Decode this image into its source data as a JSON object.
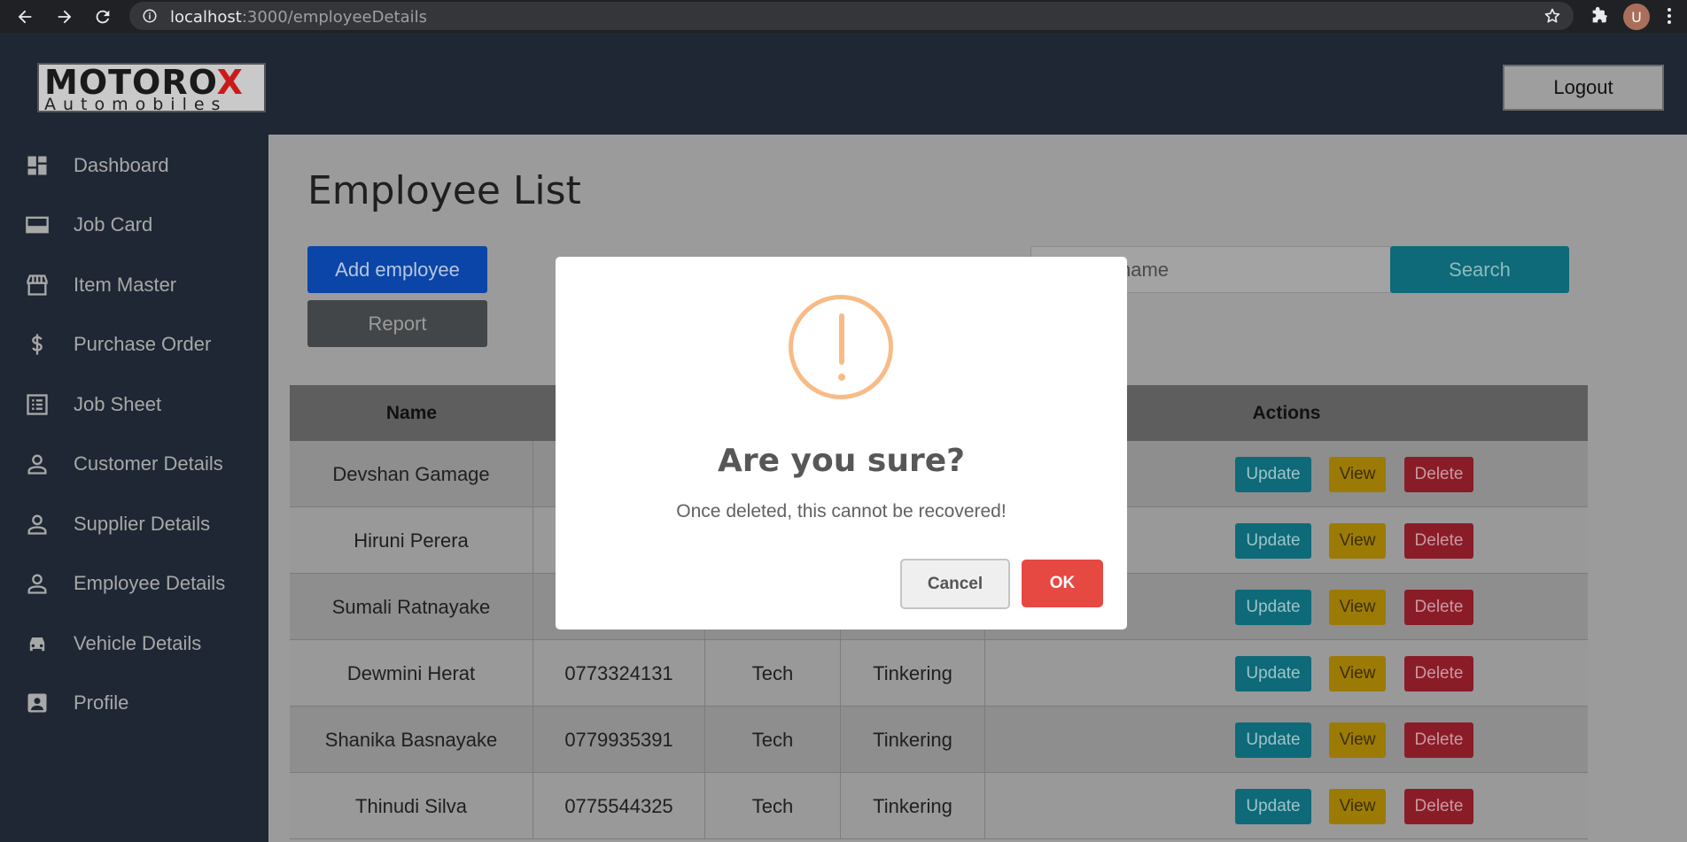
{
  "browser": {
    "url_host": "localhost",
    "url_path": ":3000/employeeDetails",
    "avatar_letter": "U"
  },
  "header": {
    "logo_top_left": "MOTORO",
    "logo_top_x": "X",
    "logo_bottom": "Automobiles",
    "logout_label": "Logout"
  },
  "sidebar": {
    "items": [
      {
        "label": "Dashboard",
        "icon": "dashboard-icon"
      },
      {
        "label": "Job Card",
        "icon": "card-icon"
      },
      {
        "label": "Item Master",
        "icon": "store-icon"
      },
      {
        "label": "Purchase Order",
        "icon": "dollar-icon"
      },
      {
        "label": "Job Sheet",
        "icon": "list-icon"
      },
      {
        "label": "Customer Details",
        "icon": "person-icon"
      },
      {
        "label": "Supplier Details",
        "icon": "person-icon"
      },
      {
        "label": "Employee Details",
        "icon": "person-icon"
      },
      {
        "label": "Vehicle Details",
        "icon": "car-icon"
      },
      {
        "label": "Profile",
        "icon": "profile-icon"
      }
    ]
  },
  "main": {
    "title": "Employee List",
    "add_label": "Add employee",
    "report_label": "Report",
    "search_value": "name",
    "search_label": "Search",
    "columns": {
      "name": "Name",
      "actions": "Actions"
    },
    "action_labels": {
      "update": "Update",
      "view": "View",
      "delete": "Delete"
    },
    "rows": [
      {
        "name": "Devshan Gamage",
        "phone": "",
        "dept": "",
        "role": ""
      },
      {
        "name": "Hiruni Perera",
        "phone": "",
        "dept": "",
        "role": ""
      },
      {
        "name": "Sumali Ratnayake",
        "phone": "",
        "dept": "",
        "role": ""
      },
      {
        "name": "Dewmini Herat",
        "phone": "0773324131",
        "dept": "Tech",
        "role": "Tinkering"
      },
      {
        "name": "Shanika Basnayake",
        "phone": "0779935391",
        "dept": "Tech",
        "role": "Tinkering"
      },
      {
        "name": "Thinudi Silva",
        "phone": "0775544325",
        "dept": "Tech",
        "role": "Tinkering"
      }
    ]
  },
  "modal": {
    "title": "Are you sure?",
    "text": "Once deleted, this cannot be recovered!",
    "cancel_label": "Cancel",
    "ok_label": "OK"
  },
  "colors": {
    "sidebar_bg": "#1e2733",
    "ok_button": "#e64942",
    "warning_icon": "#f8bb86"
  }
}
